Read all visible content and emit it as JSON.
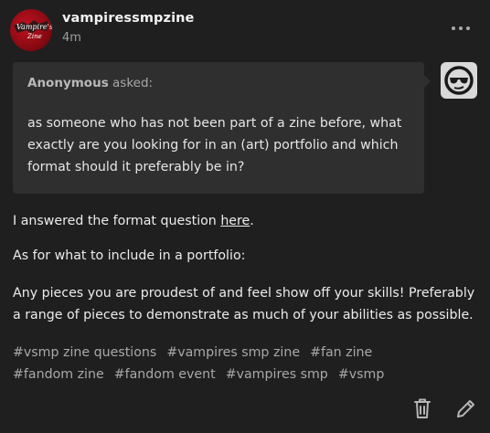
{
  "post": {
    "blog_name": "vampiressmpzine",
    "timestamp": "4m",
    "avatar_text": [
      "Vampire's",
      "Zine"
    ]
  },
  "ask": {
    "asker": "Anonymous",
    "asked_label": "asked:",
    "question": "as someone who has not been part of a zine before, what exactly are you looking for in an (art) portfolio and which format should it preferably be in?"
  },
  "answer": {
    "p1_before": "I answered the format question ",
    "p1_link": "here",
    "p1_after": ".",
    "p2": "As for what to include in a portfolio:",
    "p3_line1": "Any pieces you are proudest of and feel show off your skills! Preferably",
    "p3_line2": "a range of pieces to demonstrate as much of your abilities as possible."
  },
  "tags": [
    "#vsmp zine questions",
    "#vampires smp zine",
    "#fan zine",
    "#fandom zine",
    "#fandom event",
    "#vampires smp",
    "#vsmp"
  ],
  "icons": {
    "more": "more-options-icon",
    "delete": "trash-icon",
    "edit": "pencil-icon",
    "asker_avatar": "sunglasses-face-icon"
  },
  "colors": {
    "background": "#1f1f1f",
    "ask_bubble": "#2f2f2f",
    "text": "#ececec",
    "muted": "#a9a9a9",
    "avatar_red": "#c0121e"
  }
}
